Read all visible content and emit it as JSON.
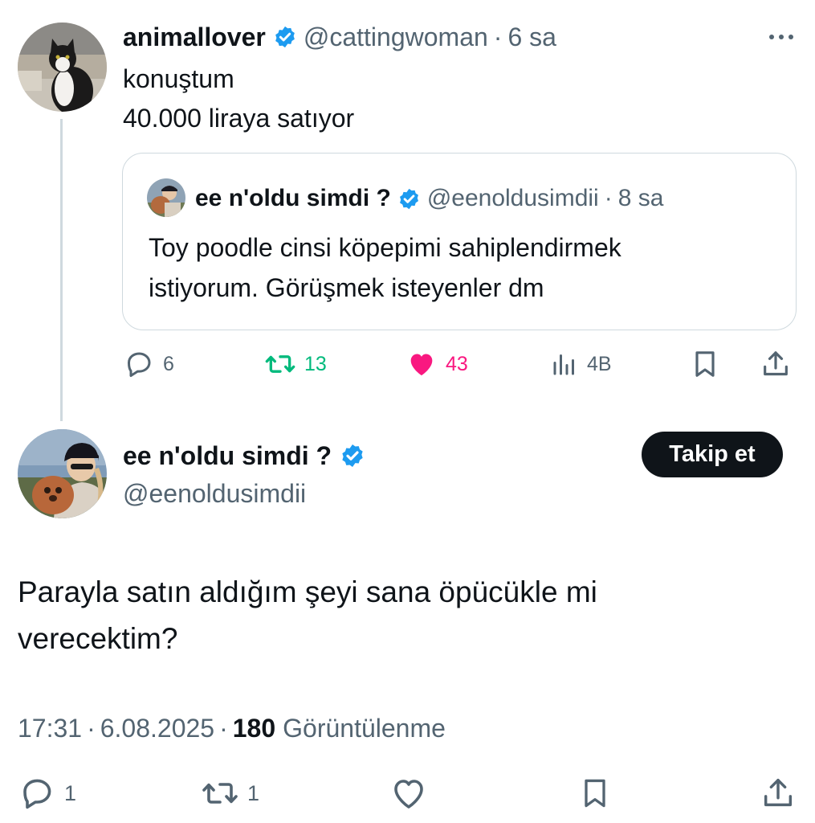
{
  "thread_tweet": {
    "display_name": "animallover",
    "handle": "@cattingwoman",
    "separator": "·",
    "time": "6 sa",
    "text_lines": [
      "konuştum",
      "40.000 liraya satıyor"
    ],
    "more_icon": "more-horizontal-icon",
    "quoted_tweet": {
      "display_name": "ee n'oldu simdi ?",
      "handle": "@eenoldusimdii",
      "separator": "·",
      "time": "8 sa",
      "text_lines": [
        "Toy poodle cinsi köpepimi sahiplendirmek",
        "istiyorum. Görüşmek isteyenler dm"
      ]
    },
    "actions": {
      "replies": "6",
      "retweets": "13",
      "likes": "43",
      "views": "4B"
    },
    "colors": {
      "retweet_active": "#00ba7c",
      "like_active": "#f91880",
      "verified": "#1d9bf0"
    }
  },
  "main_tweet": {
    "display_name": "ee n'oldu simdi ?",
    "handle": "@eenoldusimdii",
    "follow_label": "Takip et",
    "text_lines": [
      "Parayla satın aldığım şeyi sana öpücükle mi",
      "verecektim?"
    ],
    "meta": {
      "time": "17:31",
      "date": "6.08.2025",
      "separator": "·",
      "views_count": "180",
      "views_label": "Görüntülenme"
    },
    "actions": {
      "replies": "1",
      "retweets": "1"
    }
  }
}
